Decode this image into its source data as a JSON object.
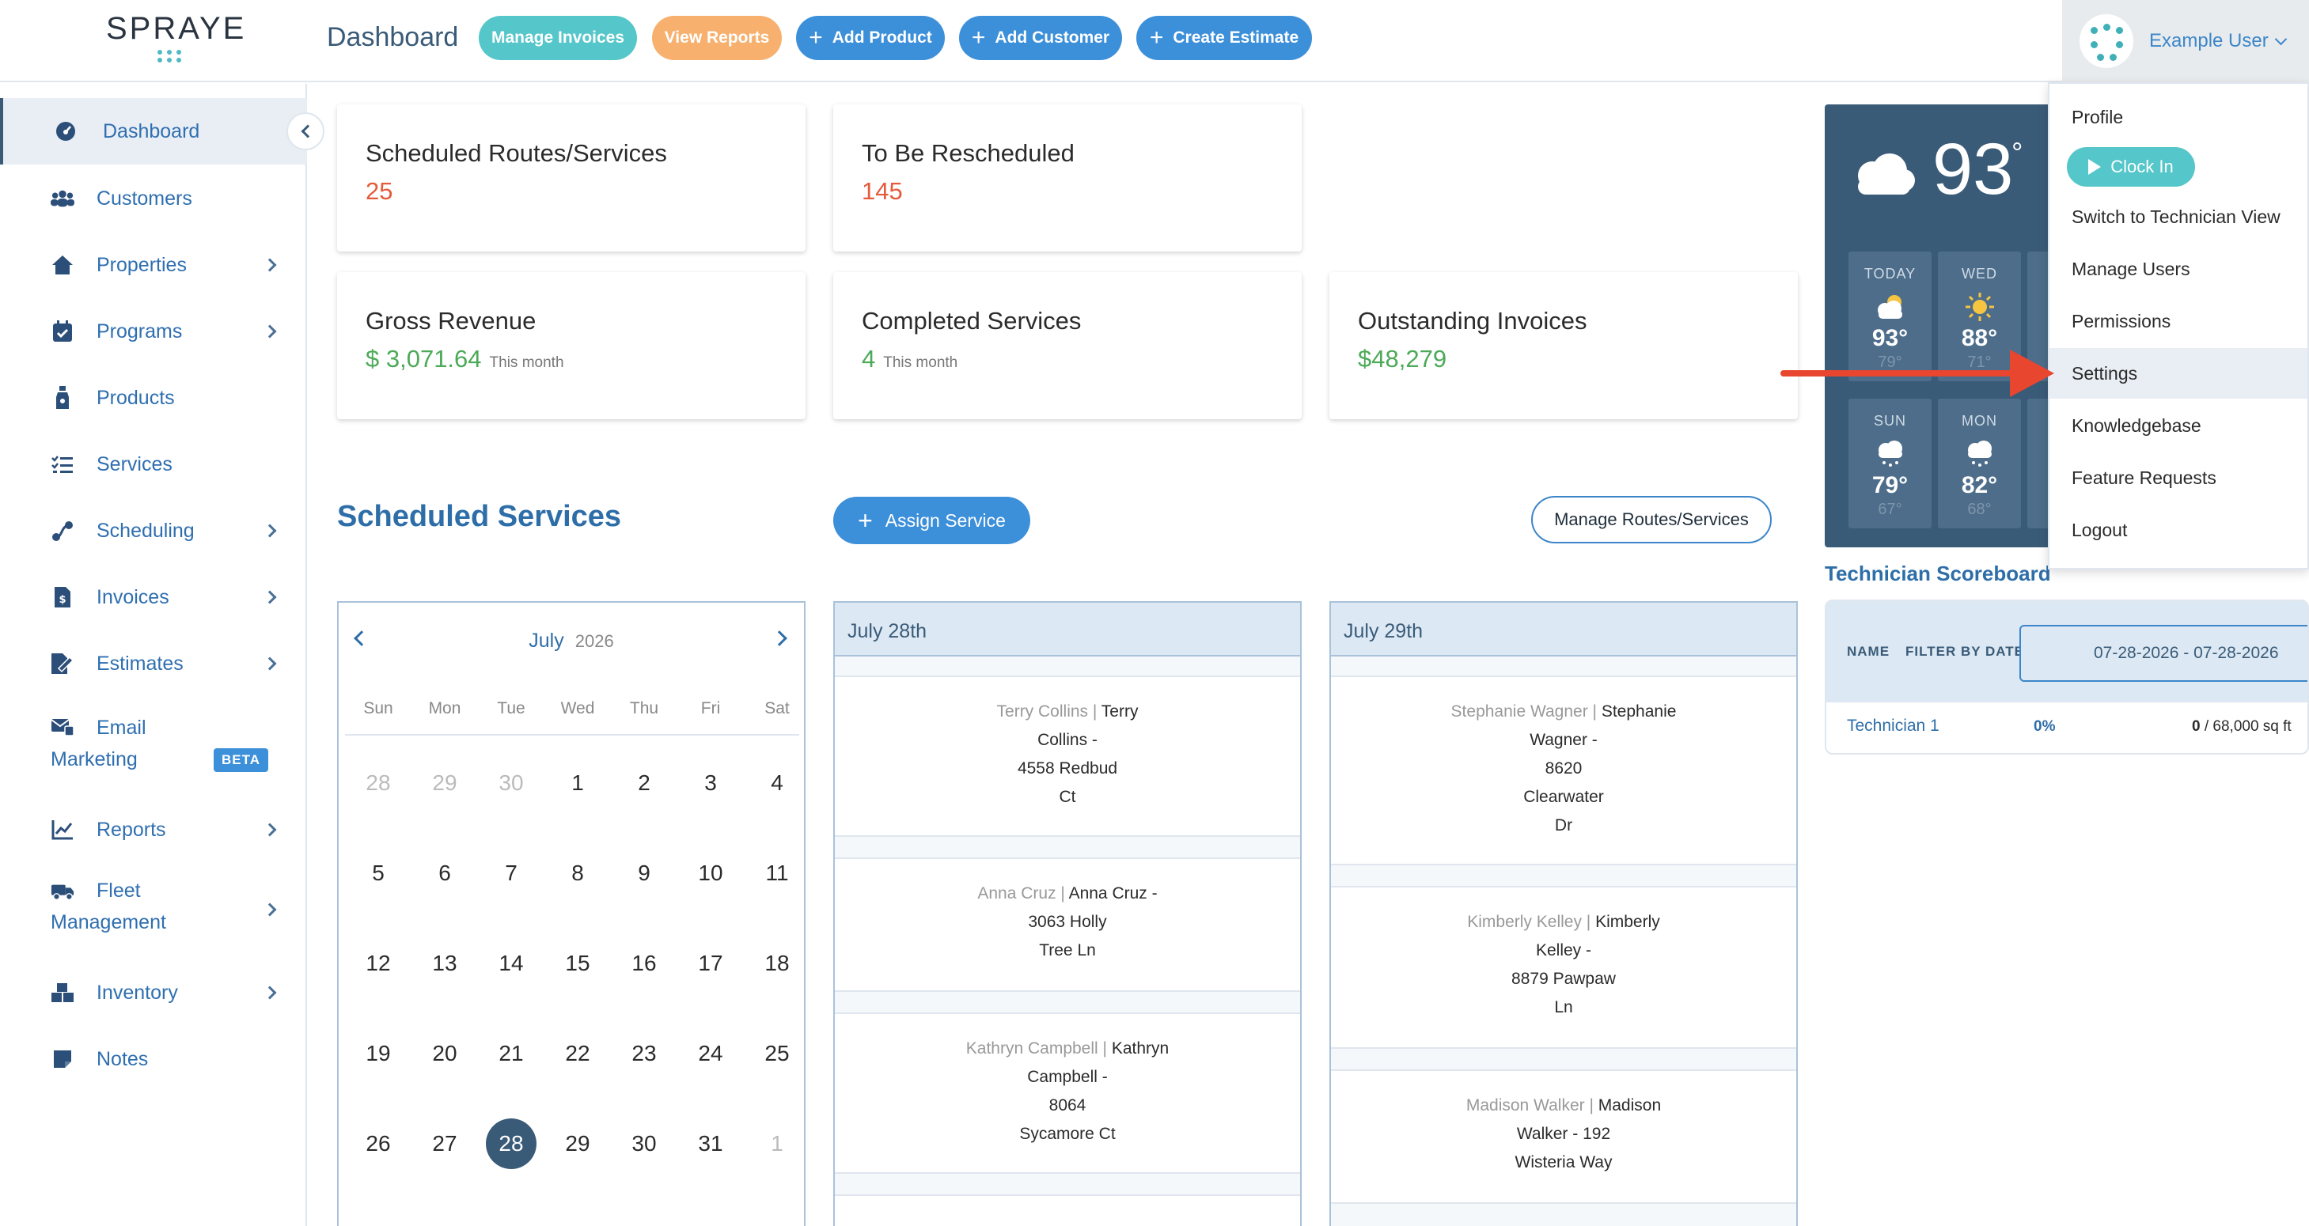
{
  "app": {
    "logo": "SPRAYE",
    "page_title": "Dashboard"
  },
  "header_buttons": {
    "manage_invoices": "Manage Invoices",
    "view_reports": "View Reports",
    "add_product": "Add Product",
    "add_customer": "Add Customer",
    "create_estimate": "Create Estimate"
  },
  "user": {
    "name": "Example User"
  },
  "sidebar": {
    "items": [
      {
        "label": "Dashboard"
      },
      {
        "label": "Customers"
      },
      {
        "label": "Properties"
      },
      {
        "label": "Programs"
      },
      {
        "label": "Products"
      },
      {
        "label": "Services"
      },
      {
        "label": "Scheduling"
      },
      {
        "label": "Invoices"
      },
      {
        "label": "Estimates"
      },
      {
        "label": "Email",
        "label2": "Marketing",
        "badge": "BETA"
      },
      {
        "label": "Reports"
      },
      {
        "label": "Fleet",
        "label2": "Management"
      },
      {
        "label": "Inventory"
      },
      {
        "label": "Notes"
      }
    ]
  },
  "stats": {
    "scheduled": {
      "title": "Scheduled Routes/Services",
      "value": "25"
    },
    "reschedule": {
      "title": "To Be Rescheduled",
      "value": "145"
    },
    "gross": {
      "title": "Gross Revenue",
      "value": "$ 3,071.64",
      "note": "This month"
    },
    "completed": {
      "title": "Completed Services",
      "value": "4",
      "note": "This month"
    },
    "outstanding": {
      "title": "Outstanding Invoices",
      "value": "$48,279"
    }
  },
  "scheduled_services": {
    "title": "Scheduled Services",
    "assign_label": "Assign Service",
    "manage_label": "Manage Routes/Services"
  },
  "calendar": {
    "month": "July",
    "year": "2026",
    "dow": [
      "Sun",
      "Mon",
      "Tue",
      "Wed",
      "Thu",
      "Fri",
      "Sat"
    ],
    "weeks": [
      [
        "28",
        "29",
        "30",
        "1",
        "2",
        "3",
        "4"
      ],
      [
        "5",
        "6",
        "7",
        "8",
        "9",
        "10",
        "11"
      ],
      [
        "12",
        "13",
        "14",
        "15",
        "16",
        "17",
        "18"
      ],
      [
        "19",
        "20",
        "21",
        "22",
        "23",
        "24",
        "25"
      ],
      [
        "26",
        "27",
        "28",
        "29",
        "30",
        "31",
        "1"
      ]
    ],
    "selected": "28"
  },
  "columns": {
    "col1": {
      "date": "July 28th",
      "services": [
        {
          "tech": "Terry Collins",
          "line1": "Terry",
          "line2": "Collins -",
          "line3": "4558 Redbud",
          "line4": "Ct"
        },
        {
          "tech": "Anna Cruz",
          "line1": "Anna Cruz -",
          "line2": "3063 Holly",
          "line3": "Tree Ln"
        },
        {
          "tech": "Kathryn Campbell",
          "line1": "Kathryn",
          "line2": "Campbell -",
          "line3": "8064",
          "line4": "Sycamore Ct"
        }
      ]
    },
    "col2": {
      "date": "July 29th",
      "services": [
        {
          "tech": "Stephanie Wagner",
          "line1": "Stephanie",
          "line2": "Wagner -",
          "line3": "8620",
          "line4": "Clearwater",
          "line5": "Dr"
        },
        {
          "tech": "Kimberly Kelley",
          "line1": "Kimberly",
          "line2": "Kelley -",
          "line3": "8879 Pawpaw",
          "line4": "Ln"
        },
        {
          "tech": "Madison Walker",
          "line1": "Madison",
          "line2": "Walker - 192",
          "line3": "Wisteria Way"
        }
      ]
    }
  },
  "weather": {
    "current": "93",
    "degree": "°",
    "days": [
      {
        "day": "TODAY",
        "high": "93°",
        "low": "79°",
        "icon": "partly-cloudy-icon"
      },
      {
        "day": "WED",
        "high": "88°",
        "low": "71°",
        "icon": "sun-icon"
      },
      {
        "day": "SUN",
        "high": "79°",
        "low": "67°",
        "icon": "rain-icon"
      },
      {
        "day": "MON",
        "high": "82°",
        "low": "68°",
        "icon": "rain-icon"
      }
    ]
  },
  "scoreboard": {
    "title": "Technician Scoreboard",
    "name_header": "NAME",
    "filter_header": "FILTER BY DATE",
    "date_range": "07-28-2026 - 07-28-2026",
    "row": {
      "name": "Technician 1",
      "percent": "0%",
      "done": "0",
      "total": "/ 68,000 sq ft"
    }
  },
  "user_menu": {
    "profile": "Profile",
    "clock_in": "Clock In",
    "switch_view": "Switch to Technician View",
    "manage_users": "Manage Users",
    "permissions": "Permissions",
    "settings": "Settings",
    "knowledgebase": "Knowledgebase",
    "feature_requests": "Feature Requests",
    "logout": "Logout"
  },
  "colors": {
    "primary": "#3c8fd9",
    "navy": "#3a5b78",
    "teal": "#55c6c9",
    "orange": "#f7b06e",
    "red_value": "#e45a3a",
    "green_value": "#4caa58",
    "arrow": "#e8462e"
  }
}
